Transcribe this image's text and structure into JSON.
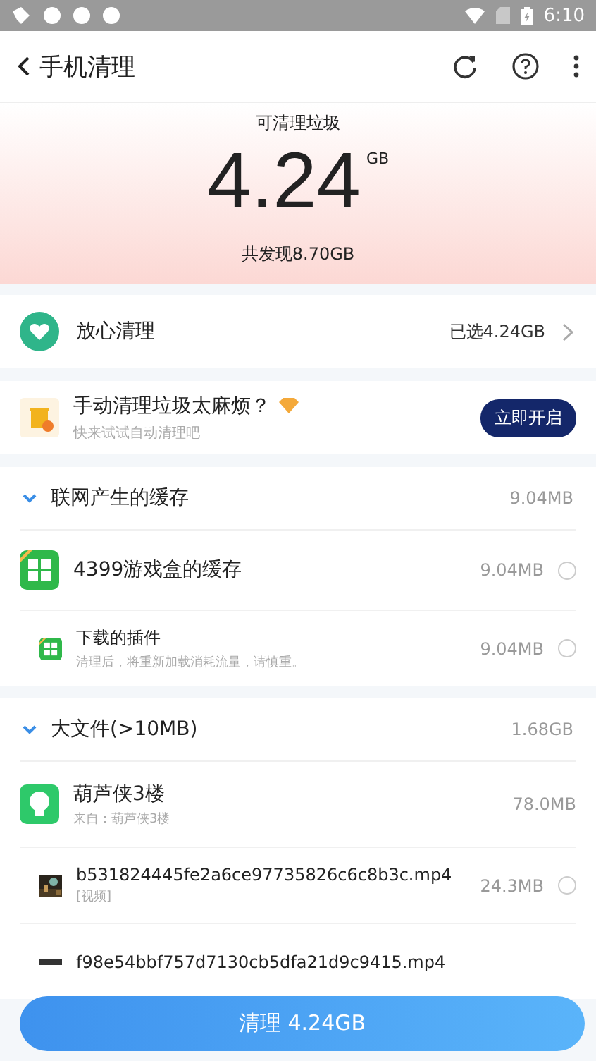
{
  "status_bar": {
    "time": "6:10"
  },
  "toolbar": {
    "title": "手机清理"
  },
  "summary": {
    "label": "可清理垃圾",
    "amount": "4.24",
    "unit": "GB",
    "found": "共发现8.70GB"
  },
  "safe_clean": {
    "label": "放心清理",
    "selected_size": "已选4.24GB"
  },
  "promo": {
    "title": "手动清理垃圾太麻烦？",
    "subtitle": "快来试试自动清理吧",
    "button": "立即开启"
  },
  "sections": [
    {
      "title": "联网产生的缓存",
      "size": "9.04MB",
      "expanded": true,
      "items": [
        {
          "kind": "app",
          "title": "4399游戏盒的缓存",
          "size": "9.04MB",
          "checked": false
        },
        {
          "kind": "sub",
          "title": "下载的插件",
          "subtitle": "清理后，将重新加载消耗流量，请慎重。",
          "size": "9.04MB",
          "checked": false
        }
      ]
    },
    {
      "title": "大文件(>10MB)",
      "size": "1.68GB",
      "expanded": true,
      "items": [
        {
          "kind": "group",
          "title": "葫芦侠3楼",
          "subtitle": "来自：葫芦侠3楼",
          "size": "78.0MB"
        },
        {
          "kind": "sub",
          "title": "b531824445fe2a6ce97735826c6c8b3c.mp4",
          "subtitle": "[视频]",
          "size": "24.3MB",
          "checked": false
        },
        {
          "kind": "sub",
          "title": "f98e54bbf757d7130cb5dfa21d9c9415.mp4"
        }
      ]
    }
  ],
  "clean_button": {
    "label": "清理 4.24GB"
  }
}
